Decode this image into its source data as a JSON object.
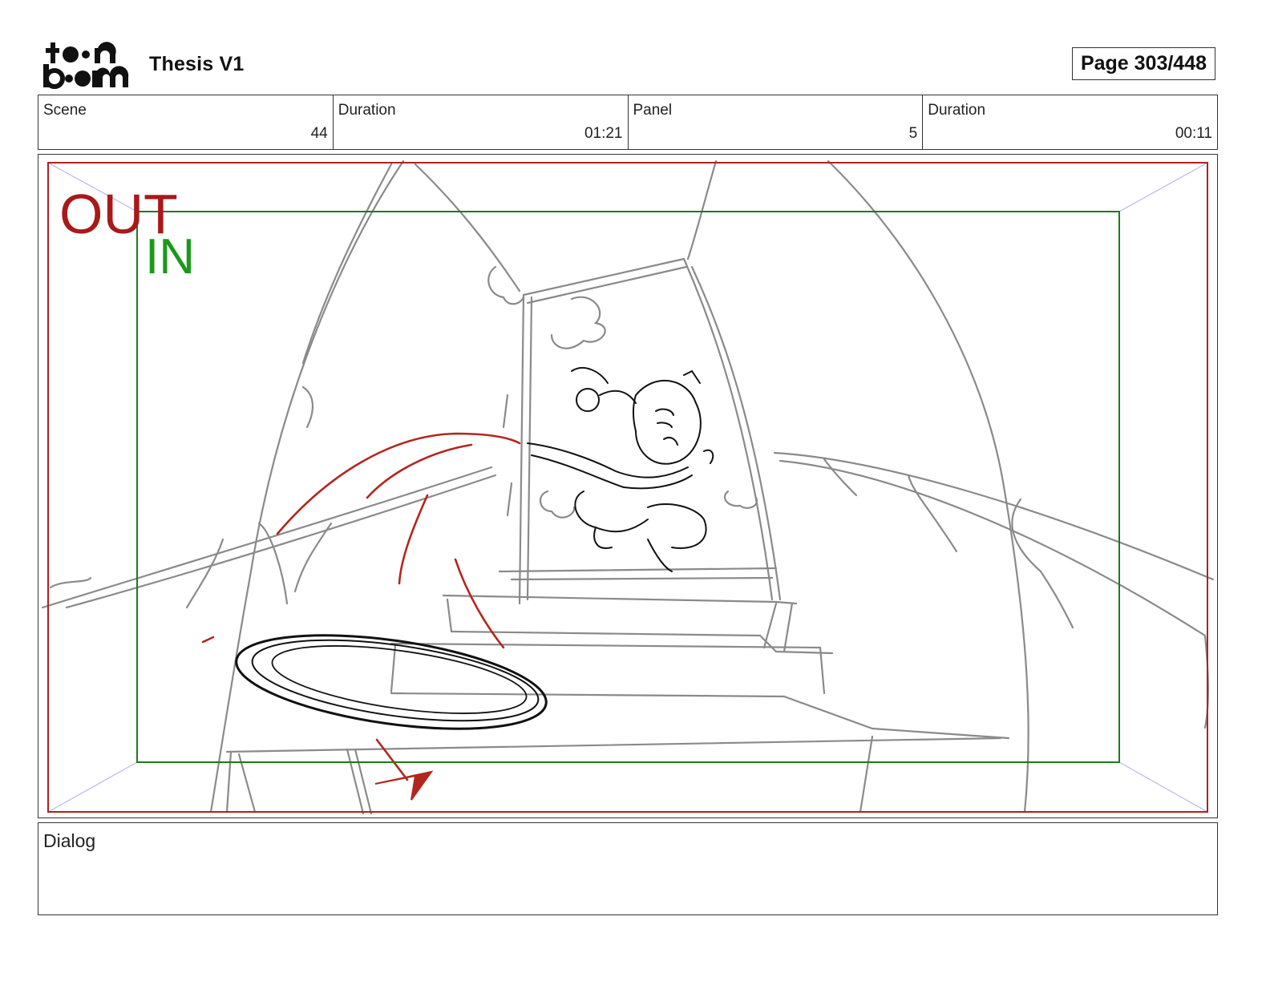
{
  "header": {
    "logo_text": "toonboom",
    "project_title": "Thesis V1",
    "page_indicator": "Page 303/448"
  },
  "info": {
    "scene_label": "Scene",
    "scene_value": "44",
    "scene_duration_label": "Duration",
    "scene_duration_value": "01:21",
    "panel_label": "Panel",
    "panel_value": "5",
    "panel_duration_label": "Duration",
    "panel_duration_value": "00:11"
  },
  "panel": {
    "out_label": "OUT",
    "in_label": "IN",
    "out_frame_color": "#b02020",
    "in_frame_color": "#1e7a1e"
  },
  "dialog": {
    "label": "Dialog",
    "text": ""
  }
}
